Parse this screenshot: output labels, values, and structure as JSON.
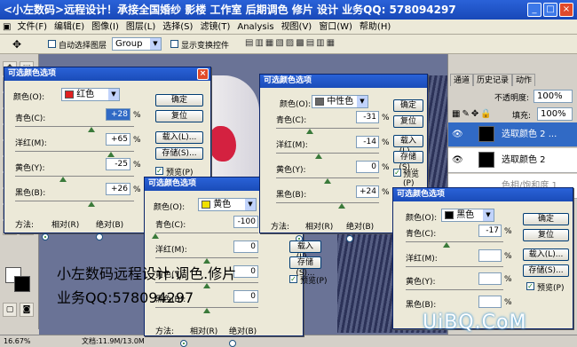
{
  "window": {
    "title": "<小左数码>远程设计！承接全国婚纱 影楼 工作室 后期调色 修片 设计 业务QQ: 578094297",
    "btn_min": "_",
    "btn_max": "□",
    "btn_close": "×"
  },
  "menu": [
    "文件(F)",
    "编辑(E)",
    "图像(I)",
    "图层(L)",
    "选择(S)",
    "滤镜(T)",
    "Analysis",
    "视图(V)",
    "窗口(W)",
    "帮助(H)"
  ],
  "options": {
    "auto_select_label": "自动选择图层",
    "group_value": "Group",
    "show_transform_label": "显示变换控件"
  },
  "panels": {
    "tabs": [
      "通道",
      "历史记录",
      "动作"
    ],
    "opacity_label": "不透明度:",
    "opacity_value": "100%",
    "fill_label": "填充:",
    "fill_value": "100%",
    "layers": [
      {
        "name": "选取颜色 2 ..."
      },
      {
        "name": "选取颜色 2"
      },
      {
        "name": "色相/饱和度 1"
      }
    ]
  },
  "status": {
    "zoom": "16.67%",
    "doc": "文档:11.9M/13.0M"
  },
  "overlay": {
    "line1": "小左数码远程设计.调色.修片",
    "line2": "业务QQ:578094297"
  },
  "watermark": "UiBQ.CoM",
  "dialog_common": {
    "title": "可选颜色选项",
    "colors_label": "颜色(O):",
    "cyan_label": "青色(C):",
    "magenta_label": "洋红(M):",
    "yellow_label": "黄色(Y):",
    "black_label": "黑色(B):",
    "ok": "确定",
    "reset": "复位",
    "load": "载入(L)...",
    "save": "存储(S)...",
    "preview": "预览(P)",
    "method": "方法:",
    "relative": "相对(R)",
    "absolute": "绝对(B)",
    "pct": "%"
  },
  "dialog1": {
    "color": "红色",
    "swatch": "#e02020",
    "cyan": "+28",
    "magenta": "+65",
    "yellow": "-25",
    "black": "+26"
  },
  "dialog2": {
    "color": "中性色",
    "swatch": "#666666",
    "cyan": "-31",
    "magenta": "-14",
    "yellow": "0",
    "black": "+24"
  },
  "dialog3": {
    "color": "黄色",
    "swatch": "#f0e000",
    "cyan": "-100",
    "magenta": "0",
    "yellow": "0",
    "black": "0"
  },
  "dialog4": {
    "color": "黑色",
    "swatch": "#000000",
    "cyan": "-17",
    "magenta": "",
    "yellow": "",
    "black": ""
  }
}
